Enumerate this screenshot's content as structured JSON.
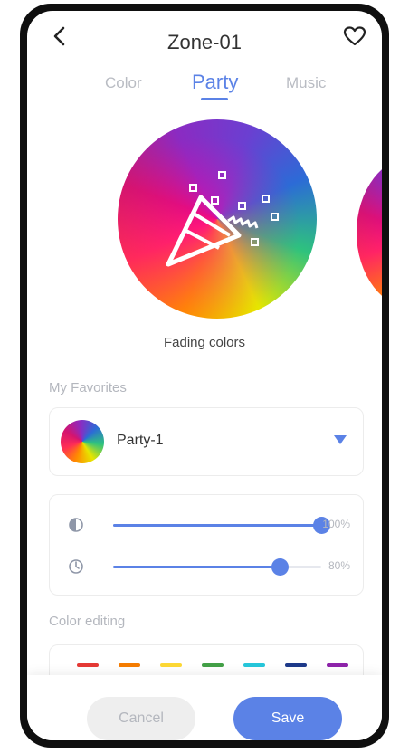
{
  "header": {
    "title": "Zone-01"
  },
  "tabs": [
    {
      "label": "Color"
    },
    {
      "label": "Party"
    },
    {
      "label": "Music"
    }
  ],
  "active_tab": "Party",
  "effect": {
    "caption": "Fading colors"
  },
  "favorites": {
    "section_label": "My Favorites",
    "selected": "Party-1"
  },
  "sliders": [
    {
      "name": "brightness",
      "value_label": "100%",
      "fraction": 1.0
    },
    {
      "name": "speed",
      "value_label": "80%",
      "fraction": 0.8
    }
  ],
  "color_editing": {
    "section_label": "Color editing",
    "swatches": [
      "#e53935",
      "#f57c00",
      "#fdd835",
      "#43a047",
      "#26c6da",
      "#1e3a8a",
      "#8e24aa"
    ]
  },
  "buttons": {
    "cancel": "Cancel",
    "save": "Save"
  },
  "colors": {
    "accent": "#5b82e6"
  }
}
